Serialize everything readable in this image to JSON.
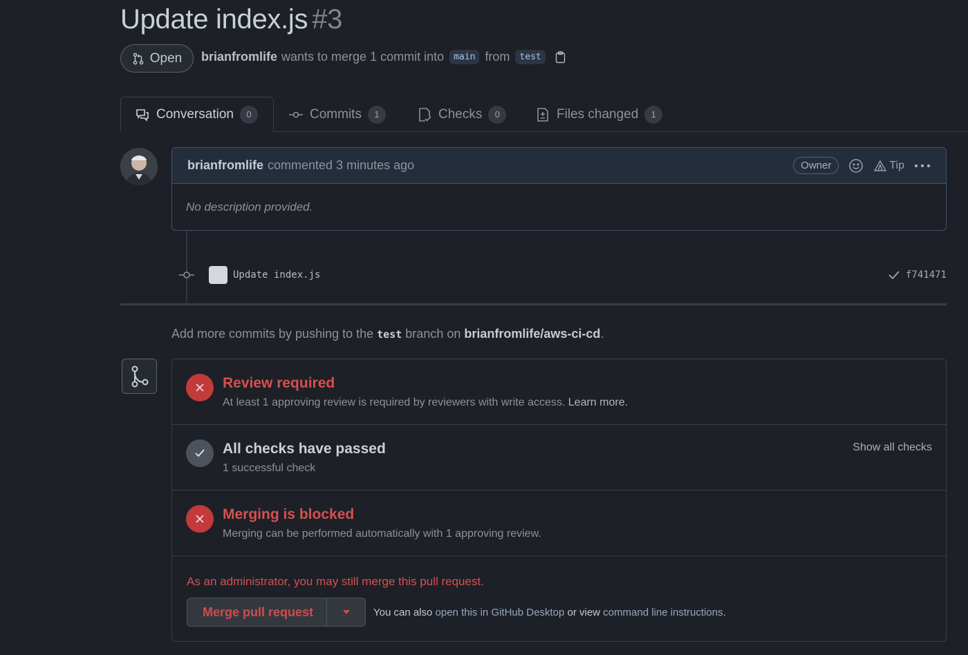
{
  "pr": {
    "title": "Update index.js",
    "number": "#3",
    "state": "Open",
    "author": "brianfromlife",
    "merge_text": "wants to merge 1 commit into",
    "base_branch": "main",
    "from_text": "from",
    "head_branch": "test"
  },
  "tabs": [
    {
      "label": "Conversation",
      "count": "0",
      "icon": "conversation-icon"
    },
    {
      "label": "Commits",
      "count": "1",
      "icon": "commit-icon"
    },
    {
      "label": "Checks",
      "count": "0",
      "icon": "checks-icon"
    },
    {
      "label": "Files changed",
      "count": "1",
      "icon": "file-diff-icon"
    }
  ],
  "comment": {
    "author": "brianfromlife",
    "action": "commented 3 minutes ago",
    "role_badge": "Owner",
    "tip_label": "Tip",
    "body": "No description provided."
  },
  "commit": {
    "message": "Update index.js",
    "sha": "f741471"
  },
  "push_hint": {
    "prefix": "Add more commits by pushing to the",
    "branch": "test",
    "middle": "branch on",
    "repo": "brianfromlife/aws-ci-cd",
    "suffix": "."
  },
  "merge_status": {
    "review": {
      "title": "Review required",
      "subtitle": "At least 1 approving review is required by reviewers with write access.",
      "link": "Learn more."
    },
    "checks": {
      "title": "All checks have passed",
      "subtitle": "1 successful check",
      "action": "Show all checks"
    },
    "blocked": {
      "title": "Merging is blocked",
      "subtitle": "Merging can be performed automatically with 1 approving review."
    },
    "admin_notice": "As an administrator, you may still merge this pull request.",
    "merge_button": "Merge pull request",
    "also_prefix": "You can also",
    "desktop_link": "open this in GitHub Desktop",
    "or_text": "or view",
    "cli_link": "command line instructions",
    "also_suffix": "."
  },
  "colors": {
    "background": "#1d2026",
    "danger": "#d4514f",
    "danger_circle": "#c23a3a",
    "branch_bg": "#2b3544"
  }
}
